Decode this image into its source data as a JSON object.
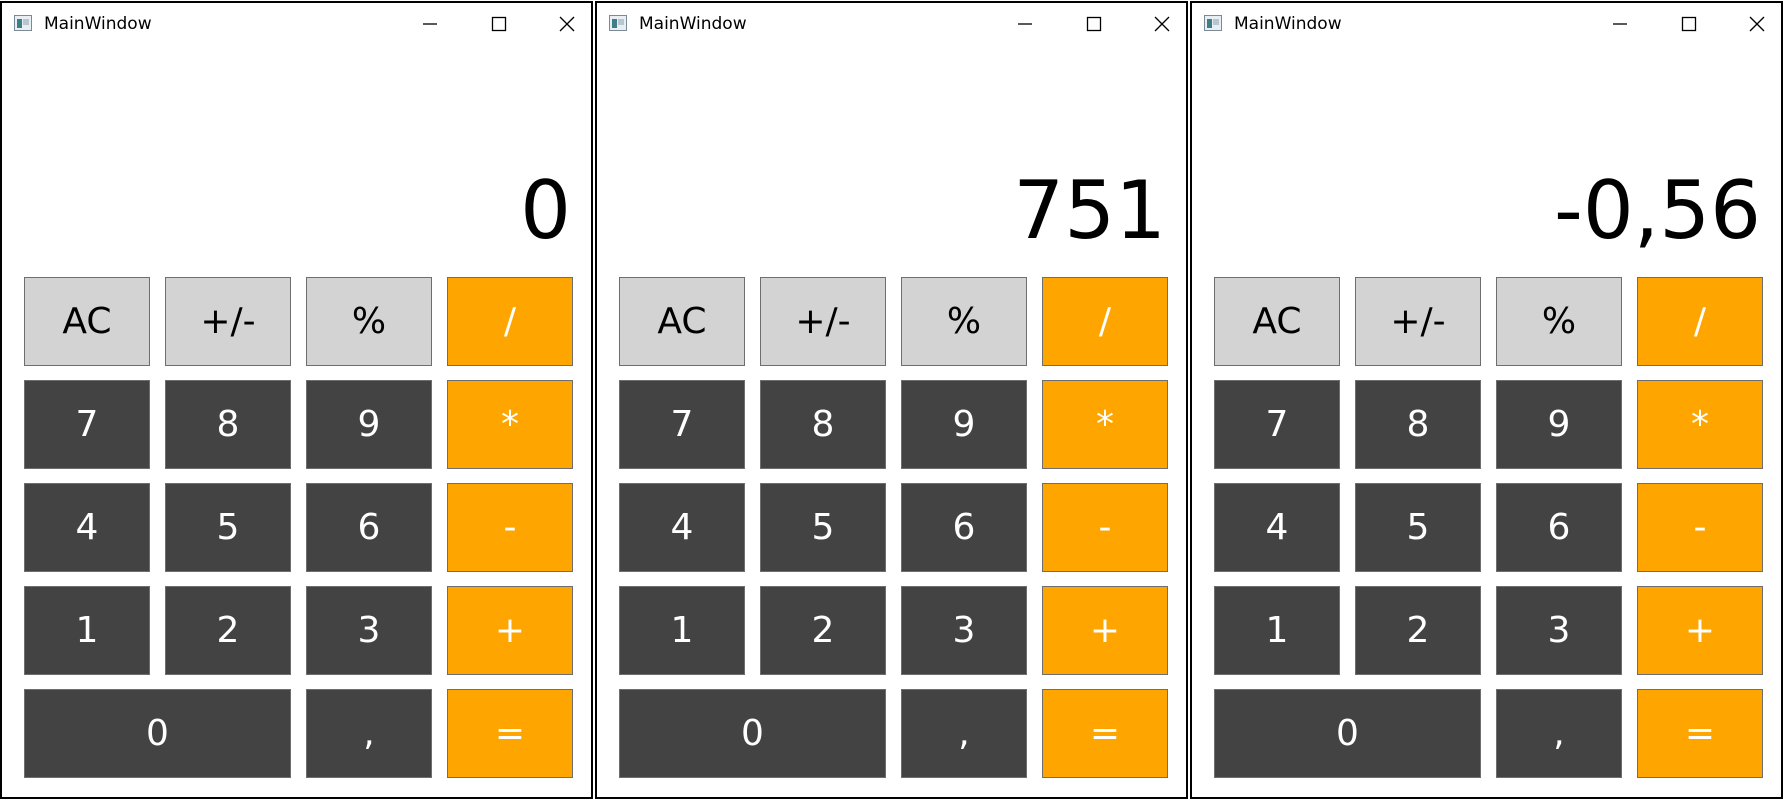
{
  "windows": [
    {
      "title": "MainWindow",
      "display": "0",
      "keys": {
        "ac": "AC",
        "sign": "+/-",
        "percent": "%",
        "divide": "/",
        "seven": "7",
        "eight": "8",
        "nine": "9",
        "multiply": "*",
        "four": "4",
        "five": "5",
        "six": "6",
        "minus": "-",
        "one": "1",
        "two": "2",
        "three": "3",
        "plus": "+",
        "zero": "0",
        "comma": ",",
        "equals": "="
      }
    },
    {
      "title": "MainWindow",
      "display": "751",
      "keys": {
        "ac": "AC",
        "sign": "+/-",
        "percent": "%",
        "divide": "/",
        "seven": "7",
        "eight": "8",
        "nine": "9",
        "multiply": "*",
        "four": "4",
        "five": "5",
        "six": "6",
        "minus": "-",
        "one": "1",
        "two": "2",
        "three": "3",
        "plus": "+",
        "zero": "0",
        "comma": ",",
        "equals": "="
      }
    },
    {
      "title": "MainWindow",
      "display": "-0,56",
      "keys": {
        "ac": "AC",
        "sign": "+/-",
        "percent": "%",
        "divide": "/",
        "seven": "7",
        "eight": "8",
        "nine": "9",
        "multiply": "*",
        "four": "4",
        "five": "5",
        "six": "6",
        "minus": "-",
        "one": "1",
        "two": "2",
        "three": "3",
        "plus": "+",
        "zero": "0",
        "comma": ",",
        "equals": "="
      }
    }
  ],
  "icons": {
    "app": "app-window-icon",
    "minimize": "minimize-icon",
    "maximize": "maximize-icon",
    "close": "close-icon"
  },
  "colors": {
    "function_key": "#d3d3d3",
    "digit_key": "#434343",
    "operator_key": "#ffa500",
    "window_border": "#000000",
    "background": "#ffffff"
  }
}
